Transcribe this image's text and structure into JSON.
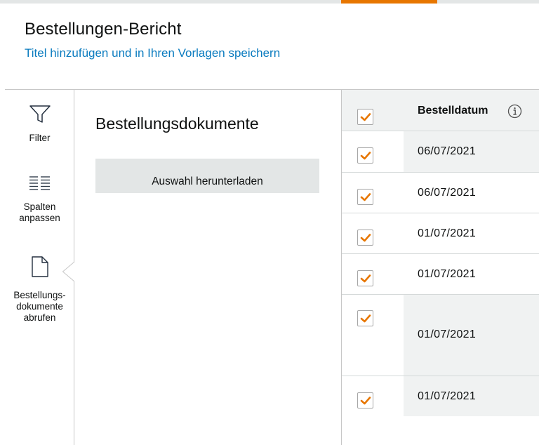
{
  "header": {
    "title": "Bestellungen-Bericht",
    "subtitle_link": "Titel hinzufügen und in Ihren Vorlagen speichern"
  },
  "sidebar": {
    "items": [
      {
        "label": "Filter",
        "icon": "filter-icon"
      },
      {
        "label": "Spalten\nanpassen",
        "icon": "columns-icon"
      },
      {
        "label": "Bestellungs-\ndokumente\nabrufen",
        "icon": "document-icon",
        "active": true
      }
    ]
  },
  "panel": {
    "title": "Bestellungsdokumente",
    "download_button": "Auswahl herunterladen"
  },
  "table": {
    "header_checked": true,
    "columns": [
      "Bestelldatum"
    ],
    "info_icon": "info-icon",
    "rows": [
      {
        "date": "06/07/2021",
        "checked": true
      },
      {
        "date": "06/07/2021",
        "checked": true
      },
      {
        "date": "01/07/2021",
        "checked": true
      },
      {
        "date": "01/07/2021",
        "checked": true
      },
      {
        "date": "01/07/2021",
        "checked": true
      },
      {
        "date": "01/07/2021",
        "checked": true
      }
    ]
  },
  "colors": {
    "accent": "#e77600",
    "link": "#0a7bbf",
    "button_bg": "#e3e6e6",
    "selected_cell_bg": "#f0f2f2"
  }
}
